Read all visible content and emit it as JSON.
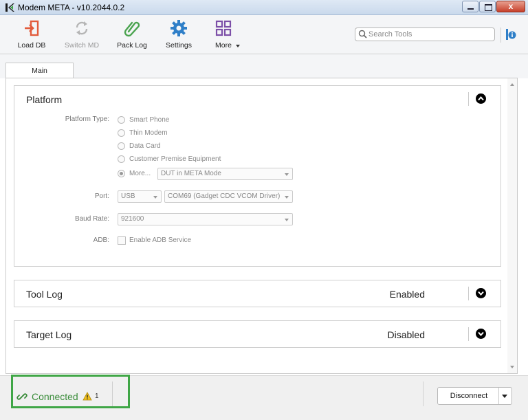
{
  "window": {
    "title": "Modem META - v10.2044.0.2",
    "close_glyph": "x"
  },
  "toolbar": {
    "items": [
      {
        "label": "Load DB",
        "icon": "load-db-icon",
        "enabled": true
      },
      {
        "label": "Switch MD",
        "icon": "switch-md-icon",
        "enabled": false
      },
      {
        "label": "Pack Log",
        "icon": "paperclip-icon",
        "enabled": true
      },
      {
        "label": "Settings",
        "icon": "gear-icon",
        "enabled": true
      },
      {
        "label": "More",
        "icon": "grid-icon",
        "enabled": true
      }
    ],
    "search_placeholder": "Search Tools"
  },
  "tabs": [
    {
      "label": "Main",
      "active": true
    }
  ],
  "platform": {
    "title": "Platform",
    "platform_type_label": "Platform Type:",
    "options": [
      {
        "label": "Smart Phone",
        "selected": false
      },
      {
        "label": "Thin Modem",
        "selected": false
      },
      {
        "label": "Data Card",
        "selected": false
      },
      {
        "label": "Customer Premise Equipment",
        "selected": false
      },
      {
        "label": "More...",
        "selected": true
      }
    ],
    "more_mode_value": "DUT in META Mode",
    "port_label": "Port:",
    "port_type_value": "USB",
    "port_value": "COM69  (Gadget CDC VCOM Driver)",
    "baud_label": "Baud Rate:",
    "baud_value": "921600",
    "adb_label": "ADB:",
    "adb_checkbox_label": "Enable ADB Service",
    "adb_checked": false
  },
  "tool_log": {
    "title": "Tool Log",
    "status": "Enabled"
  },
  "target_log": {
    "title": "Target Log",
    "status": "Disabled"
  },
  "status_bar": {
    "connection_text": "Connected",
    "connection_color": "#3a8c3a",
    "warning_count": "1",
    "disconnect_label": "Disconnect"
  },
  "colors": {
    "accent_red": "#e25b3c",
    "accent_blue": "#2f7fc8",
    "accent_green": "#4aa34f",
    "accent_purple": "#7c4fa8",
    "highlight_green": "#3fa646"
  }
}
